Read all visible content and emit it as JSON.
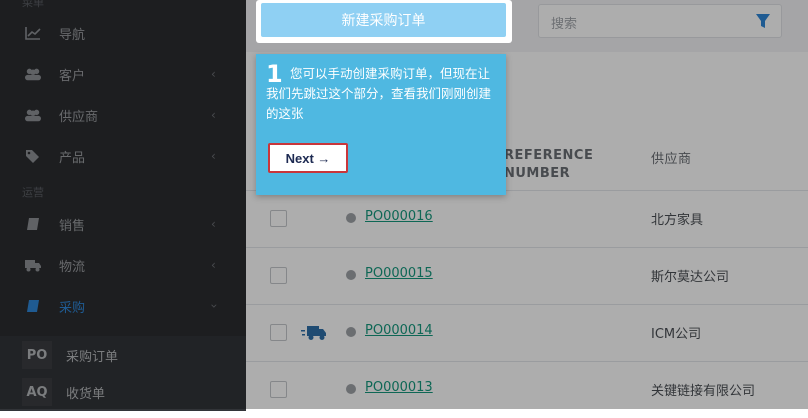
{
  "sidebar": {
    "section_top": "菜单",
    "section_ops": "运营",
    "items": [
      {
        "label": "导航",
        "icon": "chart-line-icon"
      },
      {
        "label": "客户",
        "icon": "users-icon"
      },
      {
        "label": "供应商",
        "icon": "users-icon"
      },
      {
        "label": "产品",
        "icon": "tags-icon"
      },
      {
        "label": "销售",
        "icon": "book-icon"
      },
      {
        "label": "物流",
        "icon": "truck-icon"
      },
      {
        "label": "采购",
        "icon": "book-icon"
      }
    ],
    "sub_items": [
      {
        "badge": "PO",
        "label": "采购订单"
      },
      {
        "badge": "AQ",
        "label": "收货单"
      }
    ]
  },
  "toolbar": {
    "new_po_label": "新建采购订单",
    "search_placeholder": "搜索"
  },
  "table": {
    "col_ref": "REFERENCE",
    "col_ref2": "NUMBER",
    "col_supplier": "供应商",
    "rows": [
      {
        "po": "PO000016",
        "supplier": "北方家具",
        "truck": false
      },
      {
        "po": "PO000015",
        "supplier": "斯尔莫达公司",
        "truck": false
      },
      {
        "po": "PO000014",
        "supplier": "ICM公司",
        "truck": true
      },
      {
        "po": "PO000013",
        "supplier": "关键链接有限公司",
        "truck": false
      }
    ]
  },
  "tour": {
    "step": "1",
    "text": "您可以手动创建采购订单，但现在让我们先跳过这个部分，查看我们刚刚创建的这张",
    "next_label": "Next →"
  },
  "colors": {
    "accent": "#4fb8e1",
    "link": "#15997e",
    "active": "#2f87d8"
  }
}
